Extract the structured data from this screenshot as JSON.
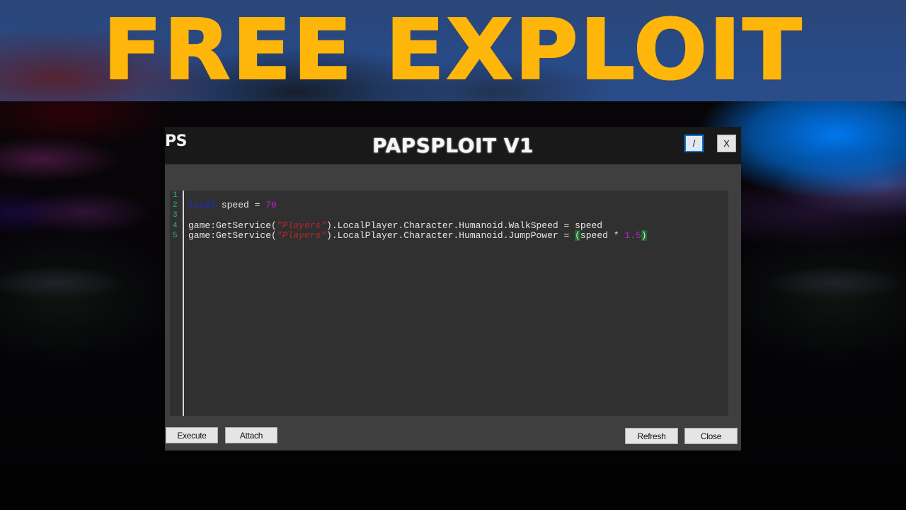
{
  "banner": {
    "title": "FREE EXPLOIT"
  },
  "window": {
    "logo": "PS",
    "title": "PAPSPLOIT V1",
    "minimize_label": "/",
    "close_label": "X"
  },
  "editor": {
    "line_numbers": [
      "1",
      "2",
      "3",
      "4",
      "5"
    ],
    "lines": [
      {
        "segments": []
      },
      {
        "segments": [
          {
            "text": "local",
            "type": "keyword"
          },
          {
            "text": " speed = ",
            "type": "plain"
          },
          {
            "text": "70",
            "type": "number"
          }
        ]
      },
      {
        "segments": []
      },
      {
        "segments": [
          {
            "text": "game:GetService(",
            "type": "plain"
          },
          {
            "text": "\"Players\"",
            "type": "string"
          },
          {
            "text": ").LocalPlayer.Character.Humanoid.WalkSpeed = speed",
            "type": "plain"
          }
        ]
      },
      {
        "segments": [
          {
            "text": "game:GetService(",
            "type": "plain"
          },
          {
            "text": "\"Players\"",
            "type": "string"
          },
          {
            "text": ").LocalPlayer.Character.Humanoid.JumpPower = ",
            "type": "plain"
          },
          {
            "text": "(",
            "type": "highlight"
          },
          {
            "text": "speed * ",
            "type": "plain"
          },
          {
            "text": "1.5",
            "type": "number"
          },
          {
            "text": ")",
            "type": "highlight"
          }
        ]
      }
    ]
  },
  "buttons": {
    "execute": "Execute",
    "attach": "Attach",
    "refresh": "Refresh",
    "close": "Close"
  },
  "colors": {
    "banner_text": "#ffb60a",
    "keyword": "#1a2bd6",
    "number": "#c21fc7",
    "string": "#b3262a",
    "line_number": "#2bb38e",
    "bracket_highlight": "#1f6a2a"
  }
}
